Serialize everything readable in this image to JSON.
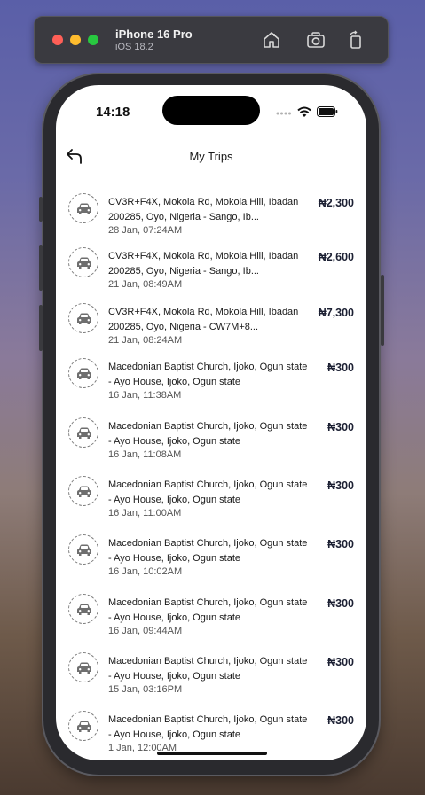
{
  "simulator": {
    "device_name": "iPhone 16 Pro",
    "os_version": "iOS 18.2",
    "icons": [
      "home-icon",
      "screenshot-icon",
      "rotate-icon"
    ]
  },
  "status_bar": {
    "time": "14:18"
  },
  "header": {
    "title": "My Trips"
  },
  "colors": {
    "price": "#1c2033",
    "text": "#1a1a1a",
    "secondary": "#555555"
  },
  "trips": [
    {
      "address": "CV3R+F4X, Mokola Rd, Mokola Hill, Ibadan 200285, Oyo, Nigeria - Sango, Ib...",
      "date": "28 Jan, 07:24AM",
      "price": "₦2,300"
    },
    {
      "address": "CV3R+F4X, Mokola Rd, Mokola Hill, Ibadan 200285, Oyo, Nigeria - Sango, Ib...",
      "date": "21 Jan, 08:49AM",
      "price": "₦2,600"
    },
    {
      "address": "CV3R+F4X, Mokola Rd, Mokola Hill, Ibadan 200285, Oyo, Nigeria - CW7M+8...",
      "date": "21 Jan, 08:24AM",
      "price": "₦7,300"
    },
    {
      "address": "Macedonian Baptist Church, Ijoko, Ogun state - Ayo House, Ijoko, Ogun state",
      "date": "16 Jan, 11:38AM",
      "price": "₦300"
    },
    {
      "address": "Macedonian Baptist Church, Ijoko, Ogun state - Ayo House, Ijoko, Ogun state",
      "date": "16 Jan, 11:08AM",
      "price": "₦300"
    },
    {
      "address": "Macedonian Baptist Church, Ijoko, Ogun state - Ayo House, Ijoko, Ogun state",
      "date": "16 Jan, 11:00AM",
      "price": "₦300"
    },
    {
      "address": "Macedonian Baptist Church, Ijoko, Ogun state - Ayo House, Ijoko, Ogun state",
      "date": "16 Jan, 10:02AM",
      "price": "₦300"
    },
    {
      "address": "Macedonian Baptist Church, Ijoko, Ogun state - Ayo House, Ijoko, Ogun state",
      "date": "16 Jan, 09:44AM",
      "price": "₦300"
    },
    {
      "address": "Macedonian Baptist Church, Ijoko, Ogun state - Ayo House, Ijoko, Ogun state",
      "date": "15 Jan, 03:16PM",
      "price": "₦300"
    },
    {
      "address": "Macedonian Baptist Church, Ijoko, Ogun state - Ayo House, Ijoko, Ogun state",
      "date": "1 Jan, 12:00AM",
      "price": "₦300"
    }
  ]
}
